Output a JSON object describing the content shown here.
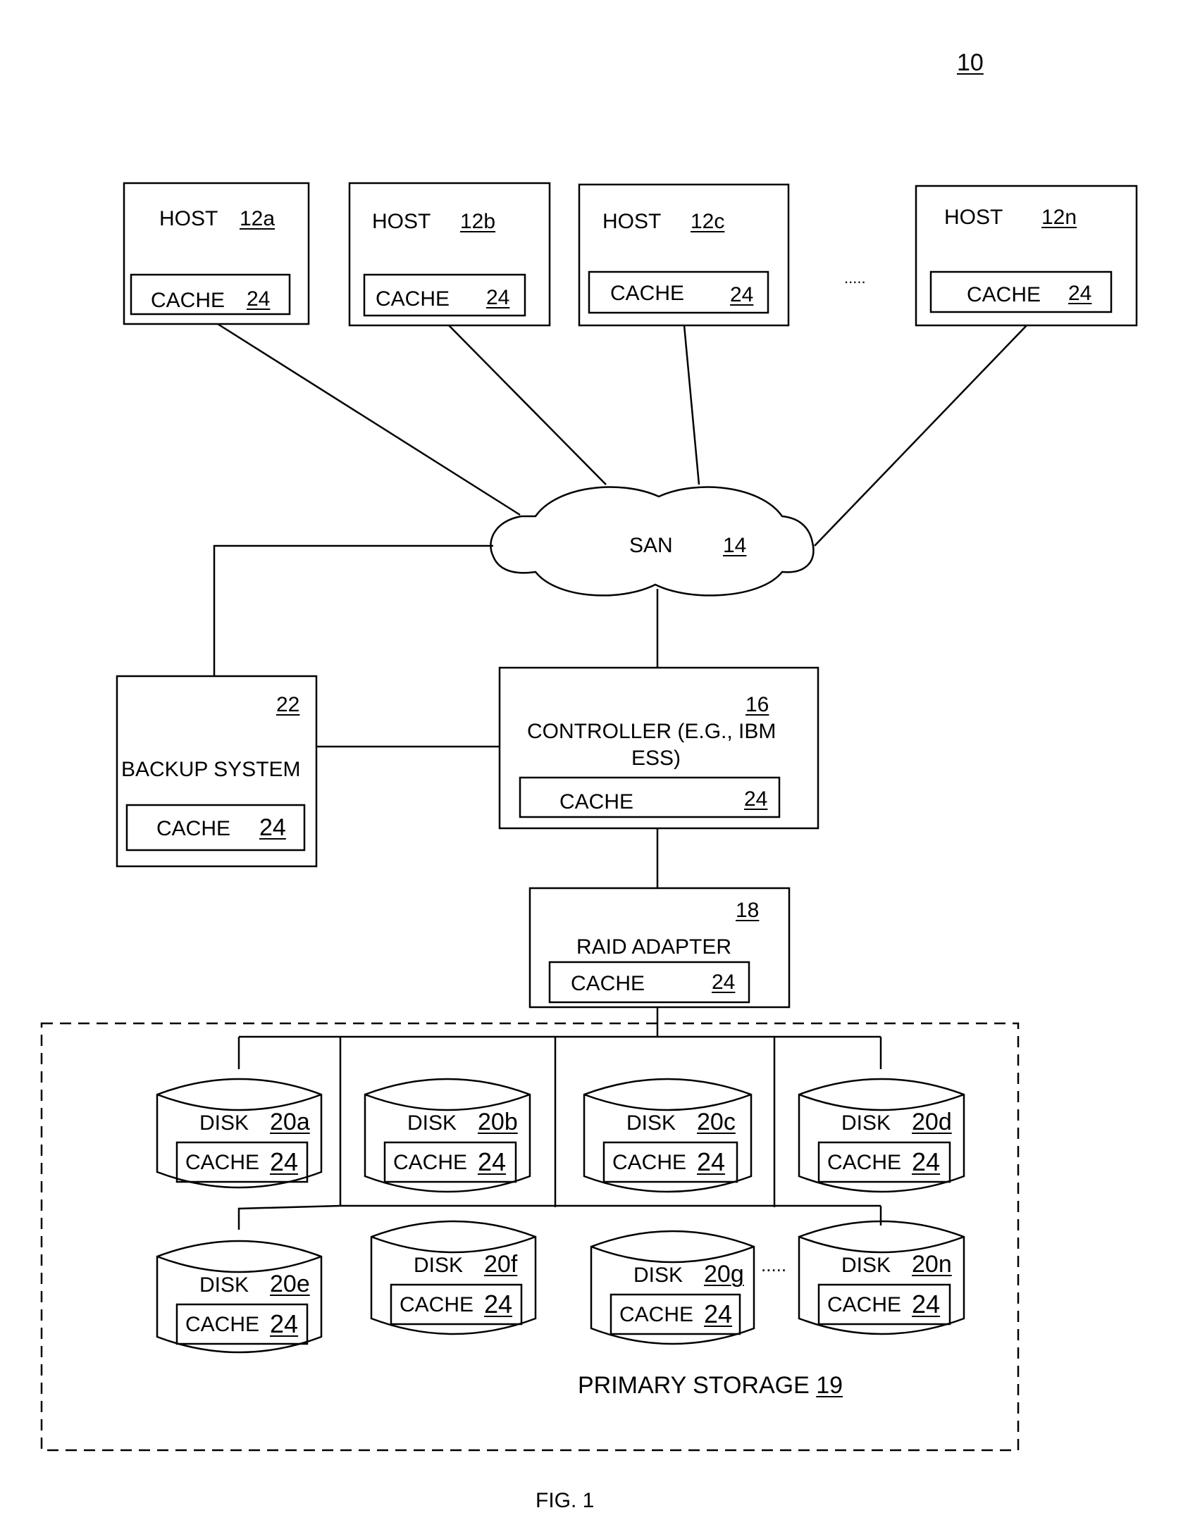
{
  "figure": {
    "ref": "10",
    "caption": "FIG. 1"
  },
  "hosts": [
    {
      "label": "HOST",
      "ref": "12a",
      "cache_label": "CACHE",
      "cache_ref": "24"
    },
    {
      "label": "HOST",
      "ref": "12b",
      "cache_label": "CACHE",
      "cache_ref": "24"
    },
    {
      "label": "HOST",
      "ref": "12c",
      "cache_label": "CACHE",
      "cache_ref": "24"
    },
    {
      "label": "HOST",
      "ref": "12n",
      "cache_label": "CACHE",
      "cache_ref": "24"
    }
  ],
  "hosts_ellipsis": ".....",
  "san": {
    "label": "SAN",
    "ref": "14"
  },
  "backup": {
    "label": "BACKUP SYSTEM",
    "ref": "22",
    "cache_label": "CACHE",
    "cache_ref": "24"
  },
  "controller": {
    "label_line1": "CONTROLLER (E.G., IBM",
    "label_line2": "ESS)",
    "ref": "16",
    "cache_label": "CACHE",
    "cache_ref": "24"
  },
  "raid": {
    "label": "RAID ADAPTER",
    "ref": "18",
    "cache_label": "CACHE",
    "cache_ref": "24"
  },
  "primary_storage": {
    "label": "PRIMARY STORAGE",
    "ref": "19"
  },
  "disks": [
    {
      "label": "DISK",
      "ref": "20a",
      "cache_label": "CACHE",
      "cache_ref": "24"
    },
    {
      "label": "DISK",
      "ref": "20b",
      "cache_label": "CACHE",
      "cache_ref": "24"
    },
    {
      "label": "DISK",
      "ref": "20c",
      "cache_label": "CACHE",
      "cache_ref": "24"
    },
    {
      "label": "DISK",
      "ref": "20d",
      "cache_label": "CACHE",
      "cache_ref": "24"
    },
    {
      "label": "DISK",
      "ref": "20e",
      "cache_label": "CACHE",
      "cache_ref": "24"
    },
    {
      "label": "DISK",
      "ref": "20f",
      "cache_label": "CACHE",
      "cache_ref": "24"
    },
    {
      "label": "DISK",
      "ref": "20g",
      "cache_label": "CACHE",
      "cache_ref": "24"
    },
    {
      "label": "DISK",
      "ref": "20n",
      "cache_label": "CACHE",
      "cache_ref": "24"
    }
  ],
  "disks_ellipsis": "....."
}
